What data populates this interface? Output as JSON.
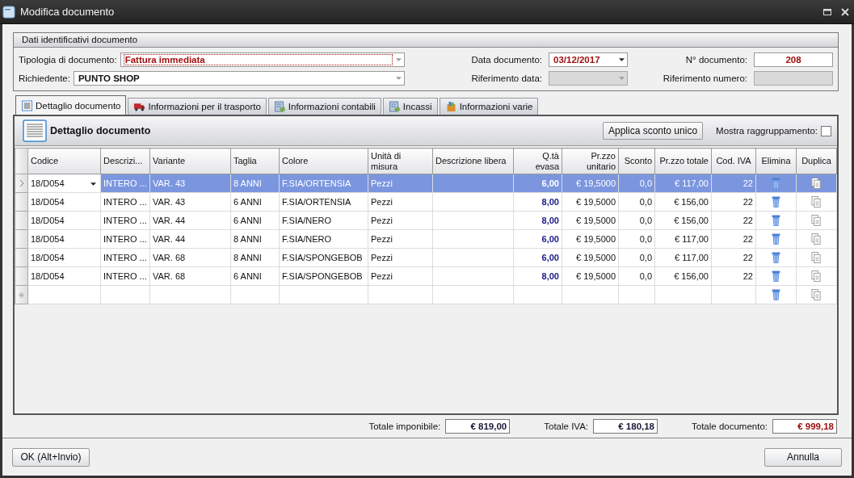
{
  "window": {
    "title": "Modifica documento"
  },
  "identification": {
    "title": "Dati identificativi documento",
    "fields": [
      {
        "label": "Tipologia di documento:",
        "value": "Fattura immediata",
        "kind": "combo",
        "highlight": true,
        "focused": true,
        "disabled": false
      },
      {
        "label": "Data documento:",
        "value": "03/12/2017",
        "kind": "date",
        "highlight": true,
        "focused": false,
        "disabled": false
      },
      {
        "label": "N° documento:",
        "value": "208",
        "kind": "text",
        "highlight": true,
        "focused": false,
        "disabled": false
      },
      {
        "label": "Richiedente:",
        "value": "PUNTO SHOP",
        "kind": "combo",
        "highlight": false,
        "focused": false,
        "disabled": false
      },
      {
        "label": "Riferimento data:",
        "kind": "combo",
        "highlight": false,
        "focused": false,
        "disabled": true
      },
      {
        "label": "Riferimento numero:",
        "kind": "text",
        "highlight": false,
        "focused": false,
        "disabled": true
      }
    ]
  },
  "tabs": [
    {
      "label": "Dettaglio documento",
      "selected": true
    },
    {
      "label": "Informazioni per il trasporto",
      "selected": false
    },
    {
      "label": "Informazioni contabili",
      "selected": false
    },
    {
      "label": "Incassi",
      "selected": false
    },
    {
      "label": "Informazioni varie",
      "selected": false
    }
  ],
  "panel": {
    "title": "Dettaglio documento",
    "apply_button": "Applica sconto unico",
    "grouping_label": "Mostra raggruppamento:",
    "grouping_checked": false
  },
  "table": {
    "columns": [
      "Codice",
      "Descrizi...",
      "Variante",
      "Taglia",
      "Colore",
      "Unità di misura",
      "Descrizione libera",
      "Q.tà evasa",
      "Pr.zzo unitario",
      "Sconto",
      "Pr.zzo totale",
      "Cod. IVA",
      "Elimina",
      "Duplica"
    ],
    "rows": [
      {
        "selected": true,
        "cells": [
          "18/D054",
          "INTERO ...",
          "VAR. 43",
          "8 ANNI",
          "F.SIA/ORTENSIA",
          "Pezzi",
          "",
          "6,00",
          "€ 19,5000",
          "0,0",
          "€ 117,00",
          "22"
        ]
      },
      {
        "selected": false,
        "cells": [
          "18/D054",
          "INTERO ...",
          "VAR. 43",
          "6 ANNI",
          "F.SIA/ORTENSIA",
          "Pezzi",
          "",
          "8,00",
          "€ 19,5000",
          "0,0",
          "€ 156,00",
          "22"
        ]
      },
      {
        "selected": false,
        "cells": [
          "18/D054",
          "INTERO ...",
          "VAR. 44",
          "6 ANNI",
          "F.SIA/NERO",
          "Pezzi",
          "",
          "8,00",
          "€ 19,5000",
          "0,0",
          "€ 156,00",
          "22"
        ]
      },
      {
        "selected": false,
        "cells": [
          "18/D054",
          "INTERO ...",
          "VAR. 44",
          "8 ANNI",
          "F.SIA/NERO",
          "Pezzi",
          "",
          "6,00",
          "€ 19,5000",
          "0,0",
          "€ 117,00",
          "22"
        ]
      },
      {
        "selected": false,
        "cells": [
          "18/D054",
          "INTERO ...",
          "VAR. 68",
          "8 ANNI",
          "F.SIA/SPONGEBOB",
          "Pezzi",
          "",
          "6,00",
          "€ 19,5000",
          "0,0",
          "€ 117,00",
          "22"
        ]
      },
      {
        "selected": false,
        "cells": [
          "18/D054",
          "INTERO ...",
          "VAR. 68",
          "6 ANNI",
          "F.SIA/SPONGEBOB",
          "Pezzi",
          "",
          "8,00",
          "€ 19,5000",
          "0,0",
          "€ 156,00",
          "22"
        ]
      }
    ]
  },
  "totals": [
    {
      "label": "Totale imponibile:",
      "value": "€ 819,00",
      "highlight": false
    },
    {
      "label": "Totale IVA:",
      "value": "€ 180,18",
      "highlight": false
    },
    {
      "label": "Totale documento:",
      "value": "€ 999,18",
      "highlight": true
    }
  ],
  "buttons": {
    "ok": "OK (Alt+Invio)",
    "cancel": "Annulla"
  }
}
